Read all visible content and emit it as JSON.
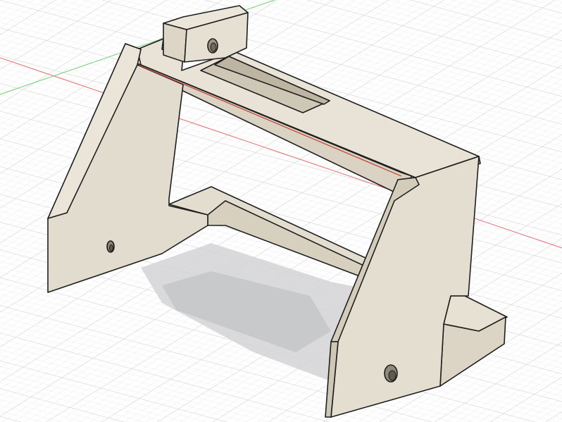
{
  "viewport": {
    "background": "#ffffff",
    "grid_minor_color": "#e4e6e9",
    "grid_major_color": "#c9ccd1",
    "x_axis_color": "#e86b6b",
    "y_axis_color": "#6ccf6c"
  },
  "model": {
    "face_light": "#e8e2d6",
    "face_mid": "#ddd6c7",
    "face_dark": "#cfc7b5",
    "edge_color": "#1e1e1e",
    "shadow_color": "#cfd0d2"
  }
}
